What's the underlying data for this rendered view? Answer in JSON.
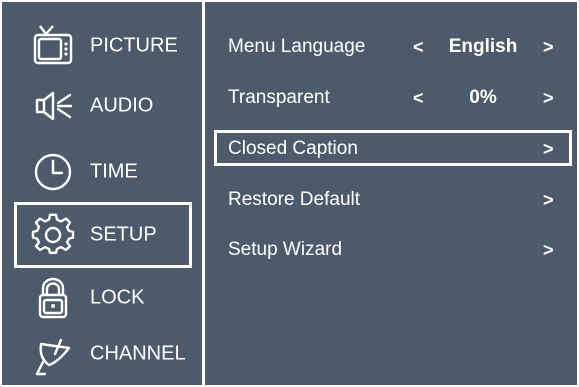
{
  "colors": {
    "panel": "#4d5a6c",
    "foreground": "#ffffff"
  },
  "sidebar": {
    "items": [
      {
        "label": "PICTURE",
        "icon": "tv-icon"
      },
      {
        "label": "AUDIO",
        "icon": "speaker-icon"
      },
      {
        "label": "TIME",
        "icon": "clock-icon"
      },
      {
        "label": "SETUP",
        "icon": "gear-icon",
        "selected": true
      },
      {
        "label": "LOCK",
        "icon": "padlock-icon"
      },
      {
        "label": "CHANNEL",
        "icon": "satellite-dish-icon"
      }
    ]
  },
  "menu": {
    "items": [
      {
        "label": "Menu Language",
        "value": "English",
        "left_arrow": "<",
        "right_arrow": ">"
      },
      {
        "label": "Transparent",
        "value": "0%",
        "left_arrow": "<",
        "right_arrow": ">"
      },
      {
        "label": "Closed Caption",
        "right_arrow": ">",
        "selected": true
      },
      {
        "label": "Restore Default",
        "right_arrow": ">"
      },
      {
        "label": "Setup Wizard",
        "right_arrow": ">"
      }
    ]
  }
}
